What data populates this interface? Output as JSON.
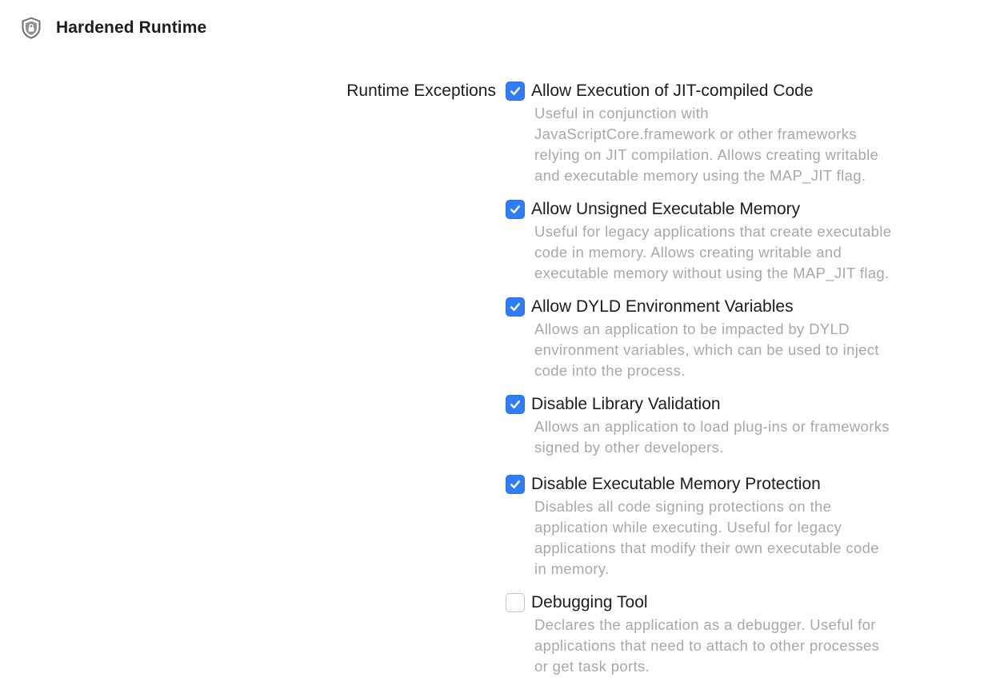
{
  "header": {
    "icon": "shield-lock-icon",
    "title": "Hardened Runtime"
  },
  "section": {
    "label": "Runtime Exceptions"
  },
  "colors": {
    "accent": "#2f7df6",
    "description_text": "#a8a8ab",
    "primary_text": "#1d1d1f"
  },
  "options": [
    {
      "label": "Allow Execution of JIT-compiled Code",
      "checked": true,
      "description_lines": [
        "Useful in conjunction with",
        "JavaScriptCore.framework or other frameworks",
        "relying on JIT compilation. Allows creating writable",
        "and executable memory using the MAP_JIT flag."
      ]
    },
    {
      "label": "Allow Unsigned Executable Memory",
      "checked": true,
      "description_lines": [
        "Useful for legacy applications that create executable",
        "code in memory. Allows creating writable and",
        "executable memory without using the MAP_JIT flag."
      ]
    },
    {
      "label": "Allow DYLD Environment Variables",
      "checked": true,
      "description_lines": [
        "Allows an application to be impacted by DYLD",
        "environment variables, which can be used to inject",
        "code into the process."
      ]
    },
    {
      "label": "Disable Library Validation",
      "checked": true,
      "description_lines": [
        "Allows an application to load plug-ins or frameworks",
        "signed by other developers."
      ]
    },
    {
      "label": "Disable Executable Memory Protection",
      "checked": true,
      "description_lines": [
        "Disables all code signing protections on the",
        "application while executing. Useful for legacy",
        "applications that modify their own executable code",
        "in memory."
      ]
    },
    {
      "label": "Debugging Tool",
      "checked": false,
      "description_lines": [
        "Declares the application as a debugger. Useful for",
        "applications that need to attach to other processes",
        "or get task ports."
      ]
    }
  ]
}
